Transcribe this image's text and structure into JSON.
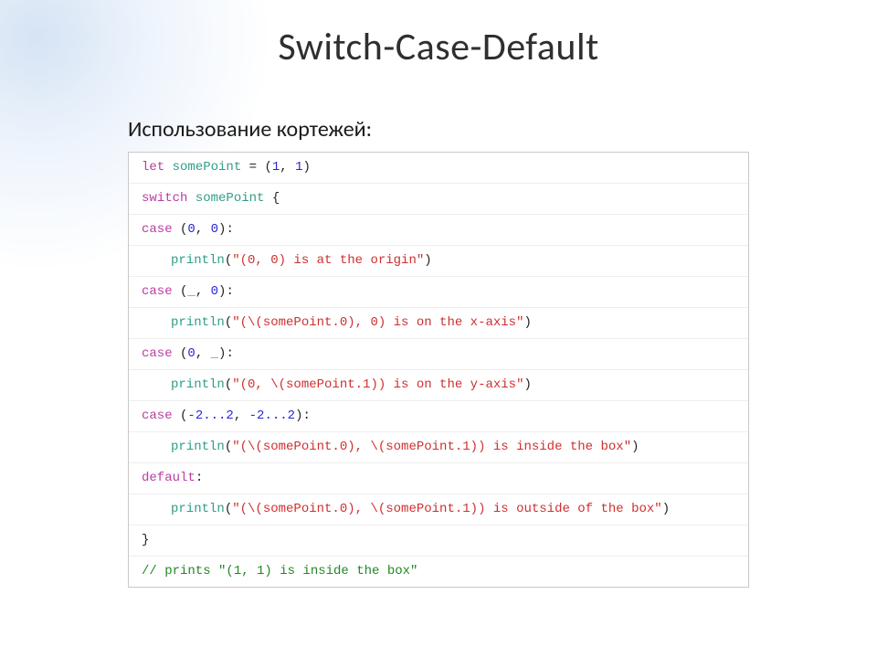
{
  "title": "Switch-Case-Default",
  "subtitle": "Использование кортежей:",
  "code": {
    "let": "let",
    "switch": "switch",
    "case": "case",
    "default": "default",
    "somePoint": "somePoint",
    "assign": " = (",
    "one_a": "1",
    "comma_sp": ", ",
    "one_b": "1",
    "close_paren": ")",
    "brace_open": " {",
    "zero": "0",
    "underscore": "_",
    "range": "-2...2",
    "println": "println",
    "paren_open": "(",
    "paren_close": ")",
    "colon": ":",
    "space": " ",
    "comma": ",",
    "str_origin": "\"(0, 0) is at the origin\"",
    "str_xaxis": "\"(\\(somePoint.0), 0) is on the x-axis\"",
    "str_yaxis": "\"(0, \\(somePoint.1)) is on the y-axis\"",
    "str_inside": "\"(\\(somePoint.0), \\(somePoint.1)) is inside the box\"",
    "str_outside": "\"(\\(somePoint.0), \\(somePoint.1)) is outside of the box\"",
    "brace_close": "}",
    "comment": "// prints \"(1, 1) is inside the box\""
  }
}
